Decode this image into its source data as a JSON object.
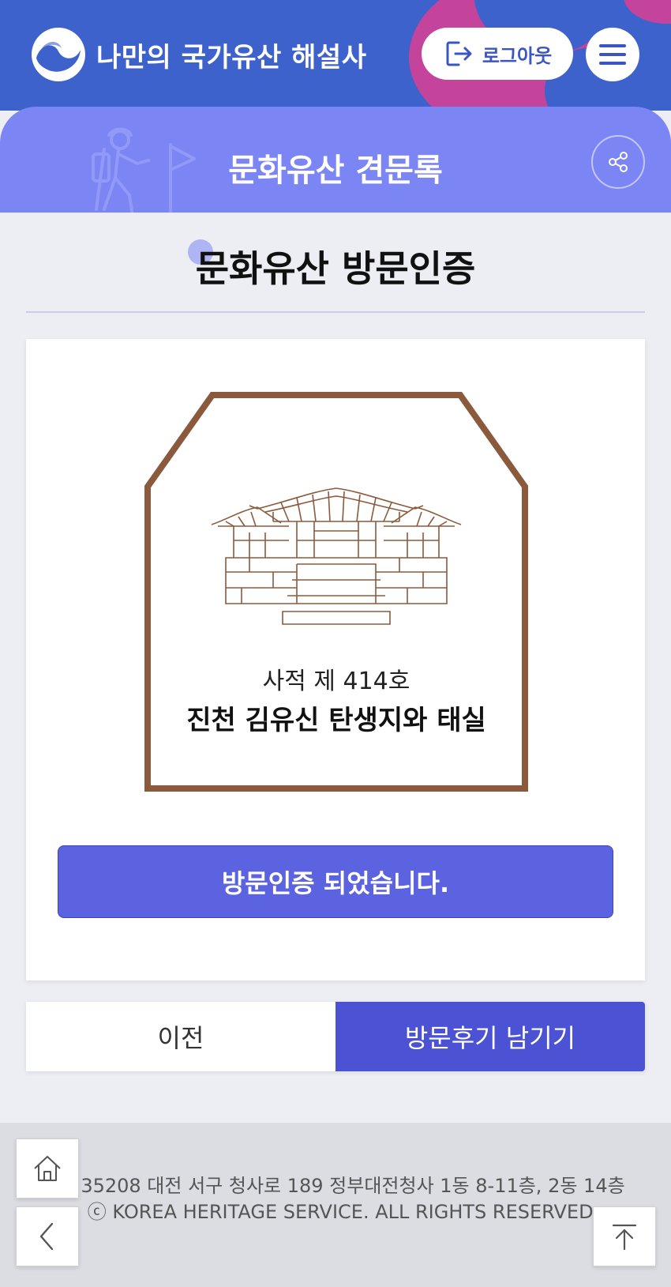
{
  "header": {
    "logo_text": "나만의 국가유산 해설사",
    "logout_label": "로그아웃",
    "logo_icon": "taegeuk-logo-icon",
    "menu_icon": "hamburger-menu-icon"
  },
  "subheader": {
    "title": "문화유산 견문록",
    "share_icon": "share-icon"
  },
  "main": {
    "page_title": "문화유산 방문인증",
    "badge": {
      "subtitle": "사적 제 414호",
      "name": "진천 김유신 탄생지와 태실"
    },
    "verified_label": "방문인증 되었습니다.",
    "prev_label": "이전",
    "review_label": "방문후기 남기기"
  },
  "footer": {
    "address": "35208 대전 서구 청사로 189 정부대전청사 1동 8-11층, 2동 14층",
    "copyright": "ⓒ KOREA HERITAGE SERVICE. ALL RIGHTS RESERVED.",
    "home_icon": "home-icon",
    "back_icon": "back-arrow-icon",
    "top_icon": "scroll-top-icon"
  },
  "colors": {
    "header_bg": "#3e62cc",
    "accent_pink": "#c3449a",
    "subheader_bg": "#7c85f4",
    "primary_button": "#5c63e0",
    "badge_frame": "#8b5a3c"
  }
}
